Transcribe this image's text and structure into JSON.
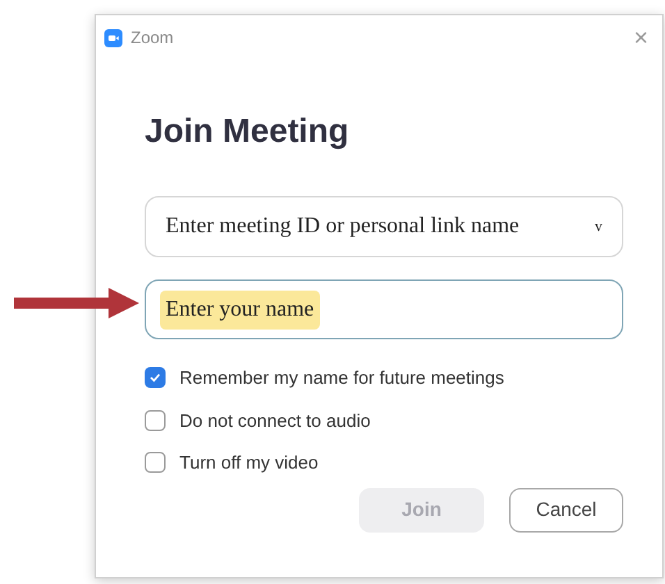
{
  "window": {
    "title": "Zoom",
    "close": "×"
  },
  "heading": "Join Meeting",
  "meeting_field": {
    "placeholder": "Enter meeting ID or personal link name",
    "caret": "v"
  },
  "name_field": {
    "placeholder": "Enter your name",
    "highlighted": true
  },
  "annotation": {
    "kind": "arrow"
  },
  "options": [
    {
      "label": "Remember my name for future meetings",
      "checked": true
    },
    {
      "label": "Do not connect to audio",
      "checked": false
    },
    {
      "label": "Turn off my video",
      "checked": false
    }
  ],
  "buttons": [
    {
      "label": "Join",
      "disabled": true
    },
    {
      "label": "Cancel",
      "disabled": false
    }
  ]
}
